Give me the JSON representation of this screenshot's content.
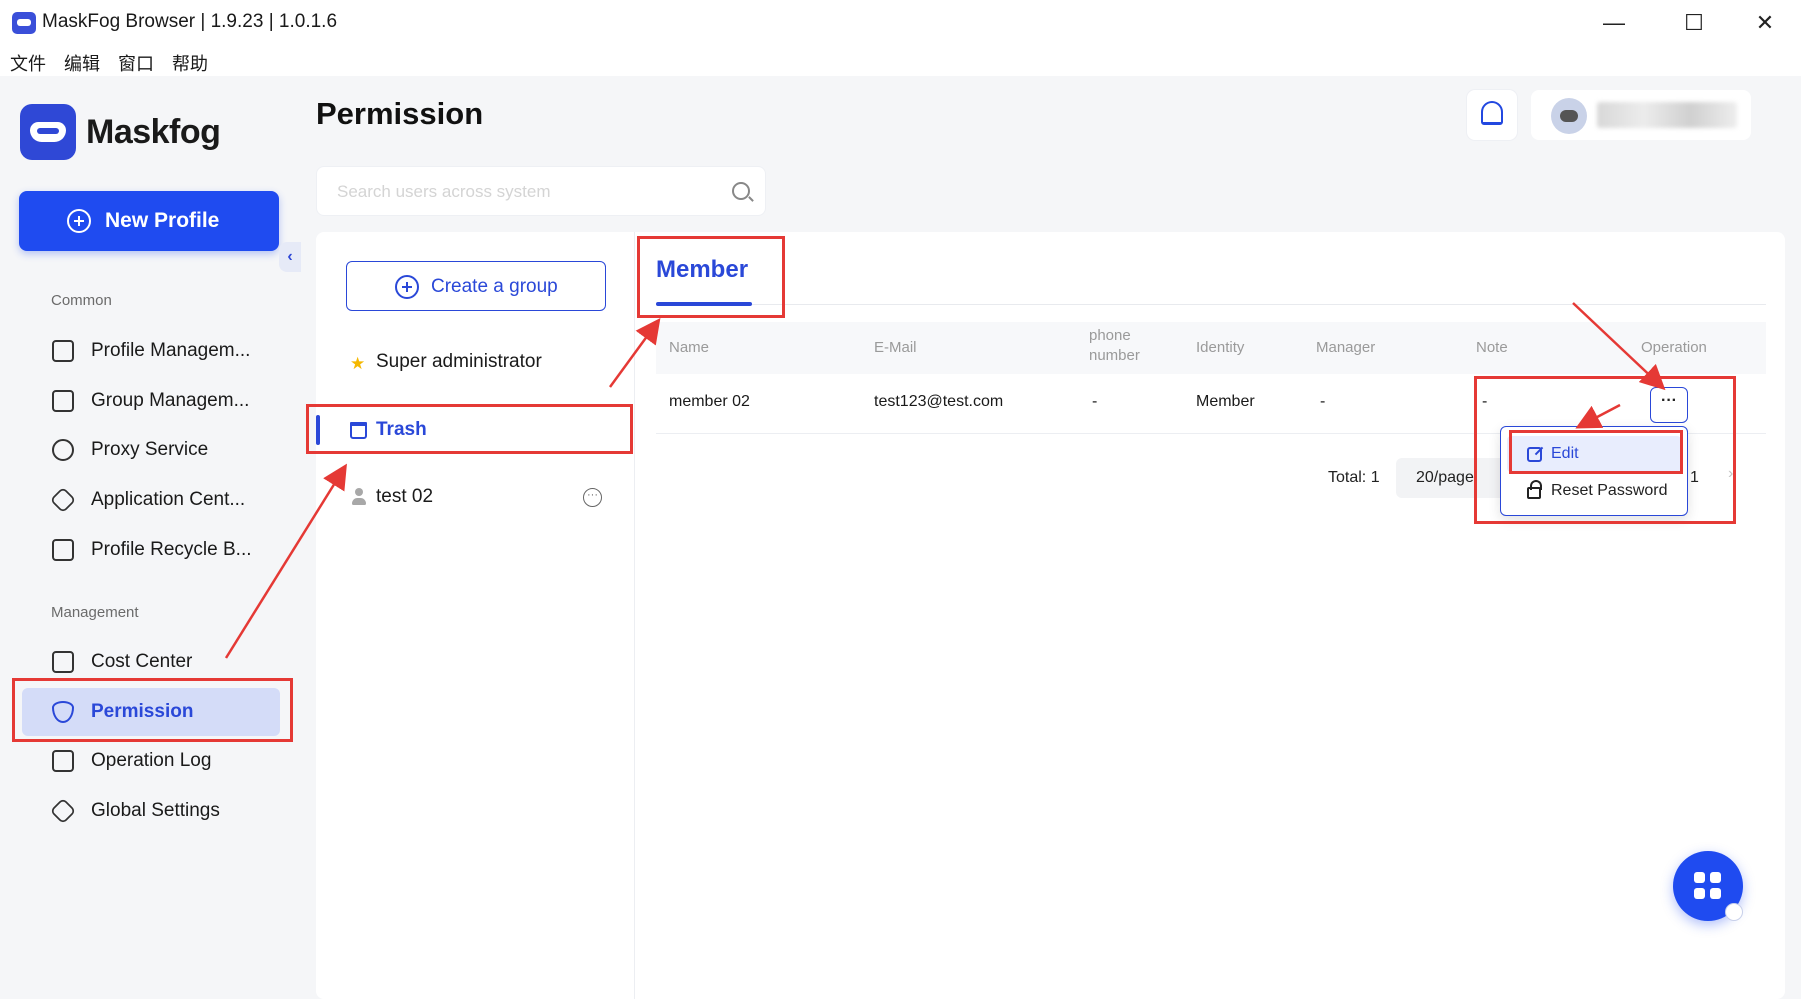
{
  "window": {
    "title": "MaskFog Browser | 1.9.23 | 1.0.1.6",
    "minimize_glyph": "—",
    "maximize_glyph": "☐",
    "close_glyph": "✕"
  },
  "menubar": [
    "文件",
    "编辑",
    "窗口",
    "帮助"
  ],
  "brand": {
    "name": "Maskfog",
    "icon": "mask-logo-icon"
  },
  "sidebar": {
    "new_profile_label": "New Profile",
    "collapse_glyph": "‹",
    "sections": [
      {
        "label": "Common",
        "items": [
          {
            "label": "Profile Managem...",
            "icon": "profile-icon"
          },
          {
            "label": "Group Managem...",
            "icon": "folder-icon"
          },
          {
            "label": "Proxy Service",
            "icon": "location-icon"
          },
          {
            "label": "Application Cent...",
            "icon": "cube-icon"
          },
          {
            "label": "Profile Recycle B...",
            "icon": "trash-icon"
          }
        ]
      },
      {
        "label": "Management",
        "items": [
          {
            "label": "Cost Center",
            "icon": "receipt-icon"
          },
          {
            "label": "Permission",
            "icon": "shield-icon",
            "active": true
          },
          {
            "label": "Operation Log",
            "icon": "clipboard-icon"
          },
          {
            "label": "Global Settings",
            "icon": "settings-icon"
          }
        ]
      }
    ]
  },
  "header": {
    "title": "Permission",
    "search_placeholder": "Search users across system",
    "notification_icon": "bell-icon"
  },
  "groups": {
    "create_label": "Create a group",
    "items": [
      {
        "label": "Super administrator",
        "icon": "star-icon"
      },
      {
        "label": "Trash",
        "icon": "trash-icon",
        "selected": true
      },
      {
        "label": "test 02",
        "icon": "user-icon",
        "more_glyph": "···"
      }
    ]
  },
  "member_panel": {
    "tab_label": "Member",
    "columns": {
      "name": "Name",
      "email": "E-Mail",
      "phone_line1": "phone",
      "phone_line2": "number",
      "identity": "Identity",
      "manager": "Manager",
      "note": "Note",
      "operation": "Operation"
    },
    "rows": [
      {
        "name": "member 02",
        "email": "test123@test.com",
        "phone": "-",
        "identity": "Member",
        "manager": "-",
        "note": "-",
        "operation_glyph": "···"
      }
    ],
    "pagination": {
      "total": "Total: 1",
      "per_page": "20/page",
      "current_page": "1",
      "next_glyph": "›"
    },
    "operation_menu": [
      {
        "label": "Edit",
        "icon": "edit-icon"
      },
      {
        "label": "Reset Password",
        "icon": "lock-icon"
      }
    ]
  },
  "colors": {
    "accent": "#2a48d8",
    "primary_button": "#1f4bf0",
    "annotation_red": "#e53935",
    "sidebar_bg": "#f5f6f8",
    "active_nav_bg": "#d4dcf8"
  }
}
